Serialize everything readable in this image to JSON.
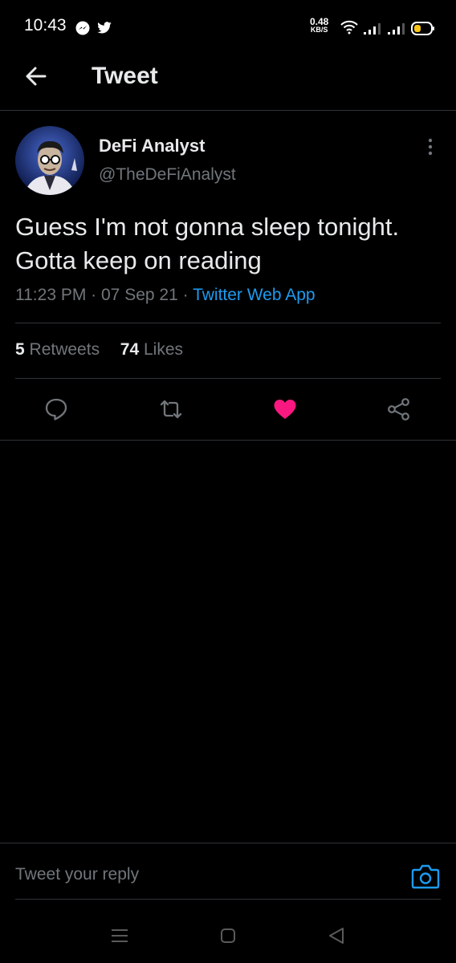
{
  "status_bar": {
    "time": "10:43",
    "net_speed_value": "0.48",
    "net_speed_unit": "KB/S",
    "icons": [
      "messenger-icon",
      "twitter-icon",
      "wifi-icon",
      "signal-icon",
      "signal-icon",
      "battery-icon"
    ]
  },
  "header": {
    "title": "Tweet",
    "back_icon": "arrow-left-icon"
  },
  "tweet": {
    "display_name": "DeFi Analyst",
    "handle": "@TheDeFiAnalyst",
    "text": "Guess I'm not gonna sleep tonight. Gotta keep on reading",
    "time": "11:23 PM",
    "date": "07 Sep 21",
    "source": "Twitter Web App",
    "retweets_count": "5",
    "retweets_label": "Retweets",
    "likes_count": "74",
    "likes_label": "Likes"
  },
  "actions": [
    "reply-icon",
    "retweet-icon",
    "like-icon",
    "share-icon"
  ],
  "colors": {
    "accent": "#1d9bf0",
    "like": "#f91880",
    "background": "#000000",
    "secondary_text": "#71767b"
  },
  "reply_bar": {
    "placeholder": "Tweet your reply"
  }
}
